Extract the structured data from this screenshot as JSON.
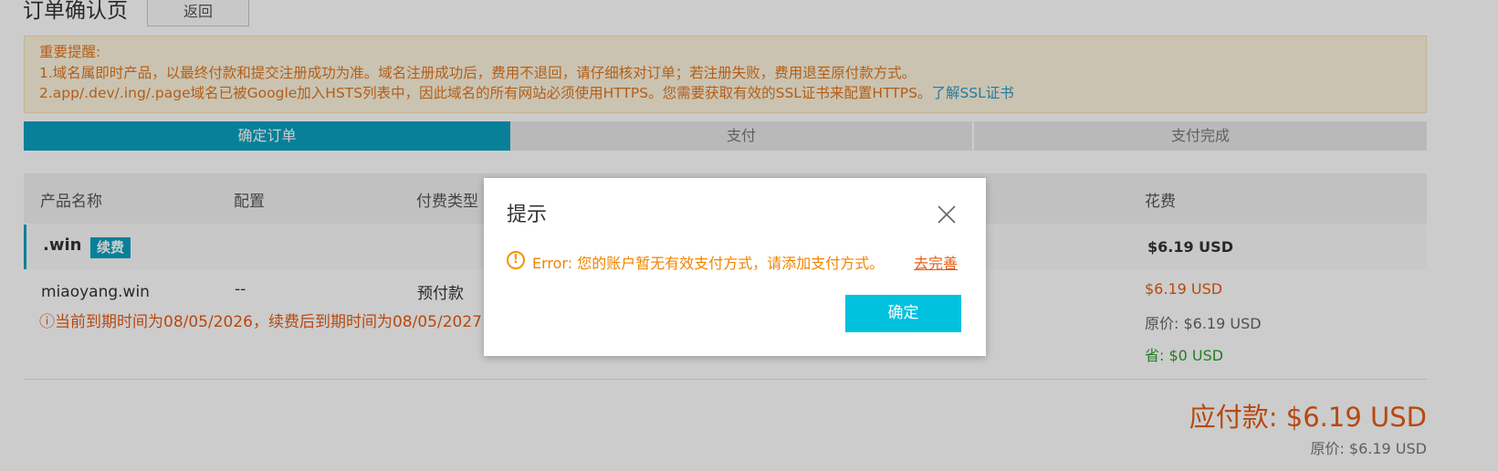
{
  "header": {
    "title": "订单确认页",
    "back_label": "返回"
  },
  "notice": {
    "heading": "重要提醒:",
    "line1": "1.域名属即时产品，以最终付款和提交注册成功为准。域名注册成功后，费用不退回，请仔细核对订单；若注册失败，费用退至原付款方式。",
    "line2": "2.app/.dev/.ing/.page域名已被Google加入HSTS列表中，因此域名的所有网站必须使用HTTPS。您需要获取有效的SSL证书来配置HTTPS。",
    "ssl_link": "了解SSL证书"
  },
  "steps": [
    "确定订单",
    "支付",
    "支付完成"
  ],
  "table": {
    "headers": {
      "product": "产品名称",
      "config": "配置",
      "pay_type": "付费类型",
      "cost": "花费"
    },
    "group": {
      "name": ".win",
      "badge": "续费",
      "price": "$6.19 USD"
    },
    "item": {
      "name": "miaoyang.win",
      "config": "--",
      "pay_type": "预付款",
      "expiry_note": "ⓘ当前到期时间为08/05/2026，续费后到期时间为08/05/2027",
      "price": "$6.19  USD",
      "original": "原价:  $6.19  USD",
      "saved": "省:  $0  USD"
    }
  },
  "total": {
    "due": "应付款:  $6.19 USD",
    "original": "原价:  $6.19  USD"
  },
  "dialog": {
    "title": "提示",
    "error_icon": "!",
    "message": "Error: 您的账户暂无有效支付方式，请添加支付方式。",
    "link": "去完善",
    "confirm_label": "确定"
  },
  "icons": {
    "close": "close-icon",
    "error": "error-icon"
  },
  "colors": {
    "accent": "#0ba1c0",
    "warning": "#e2761d",
    "price": "#e55c15",
    "button": "#00c1de"
  }
}
